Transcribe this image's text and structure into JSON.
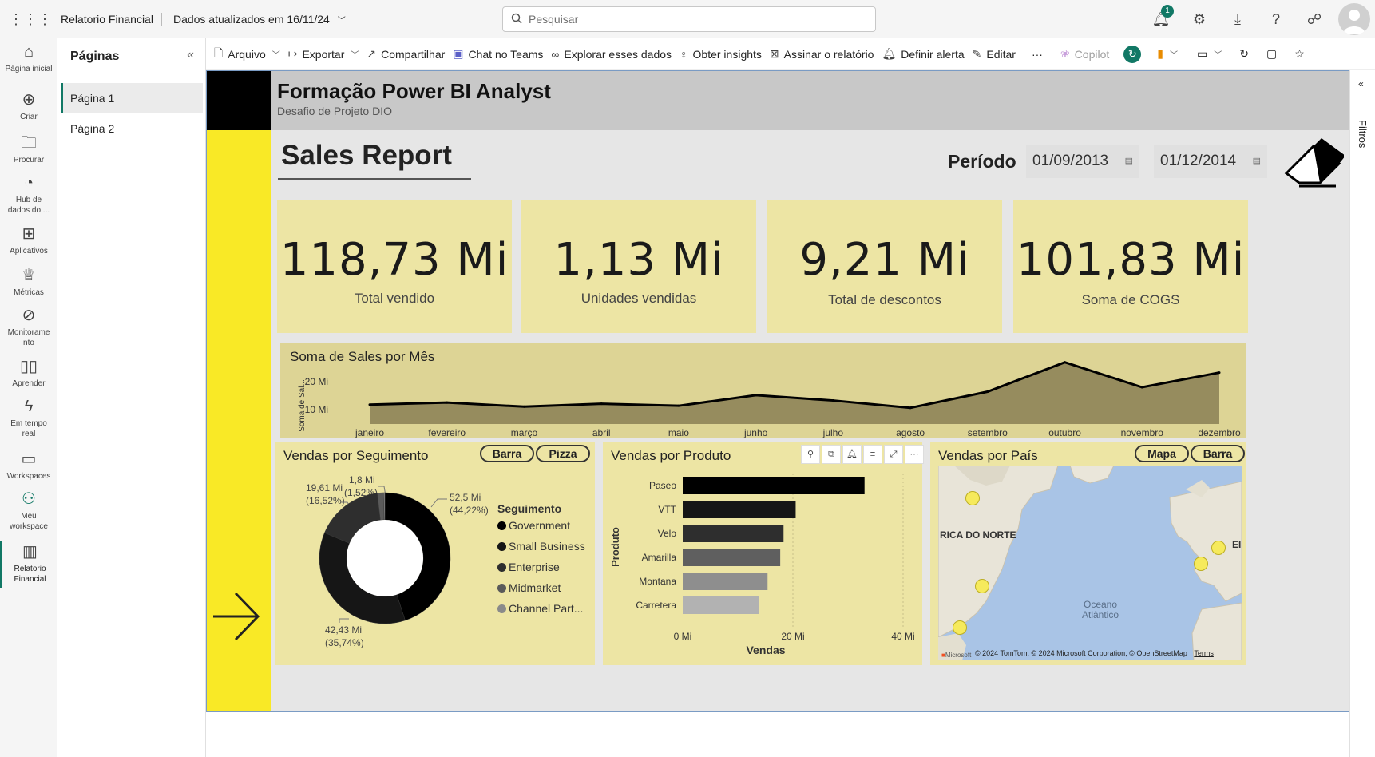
{
  "topbar": {
    "app_name": "Relatorio Financial",
    "updated": "Dados atualizados em 16/11/24",
    "search_placeholder": "Pesquisar",
    "notifications_count": "1"
  },
  "leftnav": {
    "items": [
      {
        "label": "Página inicial",
        "icon": "home-icon"
      },
      {
        "label": "Criar",
        "icon": "plus-circle-icon"
      },
      {
        "label": "Procurar",
        "icon": "folder-icon"
      },
      {
        "label": "Hub de dados do ...",
        "icon": "data-hub-icon"
      },
      {
        "label": "Aplicativos",
        "icon": "apps-icon"
      },
      {
        "label": "Métricas",
        "icon": "trophy-icon"
      },
      {
        "label": "Monitoramento",
        "icon": "monitor-icon"
      },
      {
        "label": "Aprender",
        "icon": "book-icon"
      },
      {
        "label": "Em tempo real",
        "icon": "lightning-icon"
      },
      {
        "label": "Workspaces",
        "icon": "workspaces-icon"
      },
      {
        "label": "Meu workspace",
        "icon": "person-icon"
      },
      {
        "label": "Relatorio Financial",
        "icon": "report-icon"
      }
    ]
  },
  "pages": {
    "title": "Páginas",
    "items": [
      "Página 1",
      "Página 2"
    ]
  },
  "toolbar": {
    "items": [
      "Arquivo",
      "Exportar",
      "Compartilhar",
      "Chat no Teams",
      "Explorar esses dados",
      "Obter insights",
      "Assinar o relatório",
      "Definir alerta",
      "Editar"
    ],
    "copilot": "Copilot"
  },
  "filters": {
    "label": "Filtros"
  },
  "report": {
    "title": "Formação Power BI Analyst",
    "subtitle": "Desafio de Projeto DIO",
    "sales_report": "Sales Report",
    "period_label": "Período",
    "date_start": "01/09/2013",
    "date_end": "01/12/2014"
  },
  "kpis": [
    {
      "value": "118,73 Mi",
      "label": "Total vendido"
    },
    {
      "value": "1,13 Mi",
      "label": "Unidades vendidas"
    },
    {
      "value": "9,21 Mi",
      "label": "Total de descontos"
    },
    {
      "value": "101,83 Mi",
      "label": "Soma de COGS"
    }
  ],
  "line_panel": {
    "title": "Soma de Sales por Mês",
    "ylabel": "Soma de Sal...",
    "ytick_10": "10 Mi",
    "ytick_20": "20 Mi"
  },
  "donut_panel": {
    "title": "Vendas por Seguimento",
    "toggle1": "Barra",
    "toggle2": "Pizza",
    "legend_title": "Seguimento",
    "label_gov_v": "52,5 Mi",
    "label_gov_p": "(44,22%)",
    "label_sb_v": "42,43 Mi",
    "label_sb_p": "(35,74%)",
    "label_ent_v": "19,61 Mi",
    "label_ent_p": "(16,52%)",
    "label_mid_v": "1,8 Mi",
    "label_mid_p": "(1,52%)"
  },
  "bar_panel": {
    "title": "Vendas por Produto",
    "ylabel": "Produto",
    "xlabel": "Vendas",
    "xticks": [
      "0 Mi",
      "20 Mi",
      "40 Mi"
    ]
  },
  "map_panel": {
    "title": "Vendas por País",
    "toggle1": "Mapa",
    "toggle2": "Barra",
    "label_na": "RICA DO NORTE",
    "label_ocean1": "Oceano",
    "label_ocean2": "Atlântico",
    "label_eu": "EI",
    "attribution": "© 2024 TomTom, © 2024 Microsoft Corporation, © OpenStreetMap",
    "terms": "Terms",
    "ms": "Microsoft"
  },
  "chart_data": [
    {
      "type": "area",
      "title": "Soma de Sales por Mês",
      "ylabel": "Soma de Sal...",
      "categories": [
        "janeiro",
        "fevereiro",
        "março",
        "abril",
        "maio",
        "junho",
        "julho",
        "agosto",
        "setembro",
        "outubro",
        "novembro",
        "dezembro"
      ],
      "values": [
        6.6,
        7.3,
        5.9,
        6.9,
        6.2,
        9.8,
        8.0,
        5.5,
        11.0,
        21.0,
        12.5,
        17.5
      ],
      "ylim": [
        0,
        25
      ],
      "yticks": [
        10,
        20
      ],
      "color": "#8a7f55"
    },
    {
      "type": "pie",
      "title": "Vendas por Seguimento",
      "legend_title": "Seguimento",
      "categories": [
        "Government",
        "Small Business",
        "Enterprise",
        "Midmarket",
        "Channel Part..."
      ],
      "values": [
        52.5,
        42.43,
        19.61,
        1.8,
        0.38
      ],
      "colors": [
        "#000000",
        "#161616",
        "#2e2e2e",
        "#5a5a5a",
        "#8a8a8a"
      ]
    },
    {
      "type": "bar",
      "title": "Vendas por Produto",
      "categories": [
        "Paseo",
        "VTT",
        "Velo",
        "Amarilla",
        "Montana",
        "Carretera"
      ],
      "values": [
        33.0,
        20.5,
        18.3,
        17.7,
        15.4,
        13.8
      ],
      "xlim": [
        0,
        45
      ],
      "xticks": [
        0,
        20,
        40
      ],
      "colors": [
        "#000000",
        "#161616",
        "#2e2e2e",
        "#5f5f5f",
        "#8e8e8e",
        "#b2b2b2"
      ],
      "xlabel": "Vendas",
      "ylabel": "Produto"
    }
  ]
}
